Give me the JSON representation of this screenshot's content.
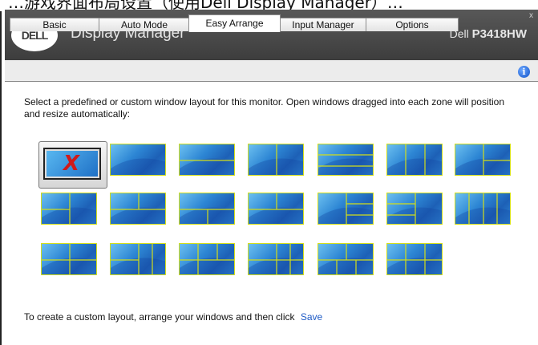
{
  "top_caption": "…游戏界面布局设置（使用Dell Display Manager）…",
  "window": {
    "brand": "DELL",
    "title": "Display Manager",
    "model_prefix": "Dell",
    "model_number": "P3418HW",
    "close_glyph": "x"
  },
  "tabs": [
    {
      "label": "Basic"
    },
    {
      "label": "Auto Mode"
    },
    {
      "label": "Easy Arrange"
    },
    {
      "label": "Input Manager"
    },
    {
      "label": "Options"
    }
  ],
  "active_tab": "Easy Arrange",
  "info_icon": {
    "glyph": "i",
    "icon": "info-icon"
  },
  "description": "Select a predefined or custom window layout for this monitor.  Open windows dragged into each zone will position and resize automatically:",
  "layouts": [
    {
      "id": "none",
      "selected": true,
      "icon": "no-layout-icon",
      "glyph": "X"
    },
    {
      "id": "full"
    },
    {
      "id": "two-rows"
    },
    {
      "id": "two-cols"
    },
    {
      "id": "three-rows"
    },
    {
      "id": "three-cols"
    },
    {
      "id": "right-split"
    },
    {
      "id": "left-split"
    },
    {
      "id": "top-left-split"
    },
    {
      "id": "bottom-split"
    },
    {
      "id": "top-right-split"
    },
    {
      "id": "right-three"
    },
    {
      "id": "left-three"
    },
    {
      "id": "four-cols"
    },
    {
      "id": "four-grid-a"
    },
    {
      "id": "four-grid-b"
    },
    {
      "id": "four-grid-c"
    },
    {
      "id": "five-grid-a"
    },
    {
      "id": "five-grid-b"
    },
    {
      "id": "six-grid"
    }
  ],
  "footer": {
    "text": "To create a custom layout, arrange your windows and then click",
    "link": "Save"
  },
  "colors": {
    "titlebar": "#4a4a4a",
    "zone_border": "#d3de1a",
    "link": "#1e5bc6",
    "red_x": "#d11a1a"
  }
}
